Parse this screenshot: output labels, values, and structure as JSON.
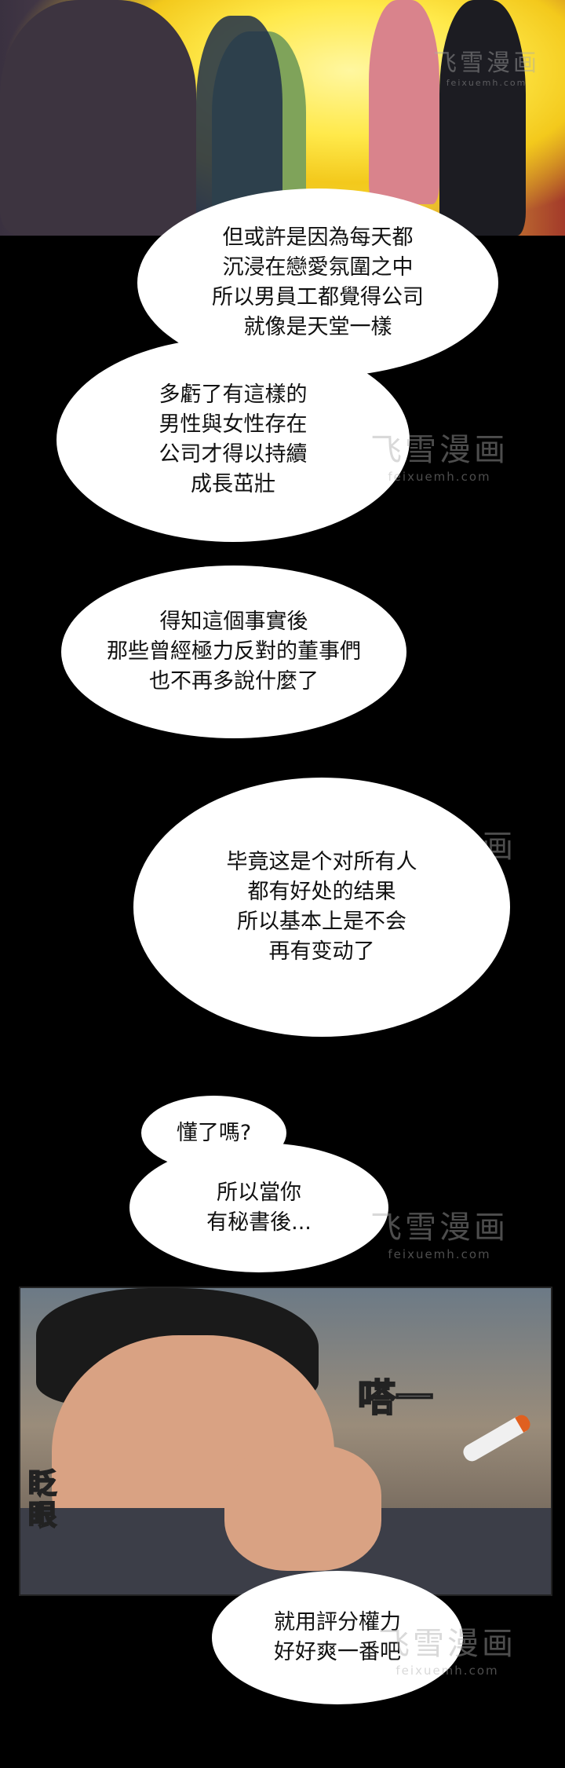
{
  "bubbles": [
    "但或許是因為每天都\n沉浸在戀愛氛圍之中\n所以男員工都覺得公司\n就像是天堂一樣",
    "多虧了有這樣的\n男性與女性存在\n公司才得以持續\n成長茁壯",
    "得知這個事實後\n那些曾經極力反對的董事們\n也不再多說什麼了",
    "毕竟这是个对所有人\n都有好处的结果\n所以基本上是不会\n再有变动了",
    "懂了嗎?",
    "所以當你\n有秘書後...",
    "就用評分權力\n好好爽一番吧"
  ],
  "sfx": {
    "sound": "嗒一",
    "blink": "眨眼"
  },
  "watermark": {
    "title": "飞雪漫画",
    "url": "feixuemh.com"
  }
}
